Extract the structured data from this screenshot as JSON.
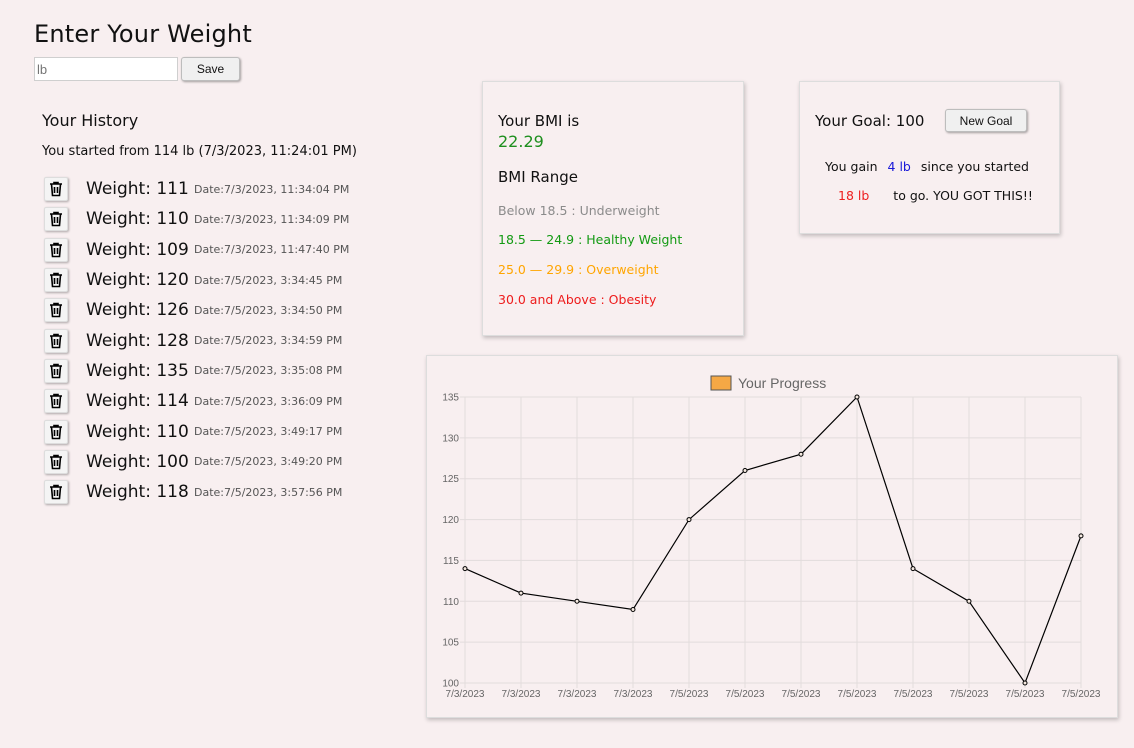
{
  "entry": {
    "title": "Enter Your Weight",
    "placeholder": "lb",
    "save_label": "Save"
  },
  "history": {
    "title": "Your History",
    "started_text": "You started from 114 lb (7/3/2023, 11:24:01 PM)",
    "items": [
      {
        "weight": "Weight: 111",
        "date": "Date:7/3/2023, 11:34:04 PM"
      },
      {
        "weight": "Weight: 110",
        "date": "Date:7/3/2023, 11:34:09 PM"
      },
      {
        "weight": "Weight: 109",
        "date": "Date:7/3/2023, 11:47:40 PM"
      },
      {
        "weight": "Weight: 120",
        "date": "Date:7/5/2023, 3:34:45 PM"
      },
      {
        "weight": "Weight: 126",
        "date": "Date:7/5/2023, 3:34:50 PM"
      },
      {
        "weight": "Weight: 128",
        "date": "Date:7/5/2023, 3:34:59 PM"
      },
      {
        "weight": "Weight: 135",
        "date": "Date:7/5/2023, 3:35:08 PM"
      },
      {
        "weight": "Weight: 114",
        "date": "Date:7/5/2023, 3:36:09 PM"
      },
      {
        "weight": "Weight: 110",
        "date": "Date:7/5/2023, 3:49:17 PM"
      },
      {
        "weight": "Weight: 100",
        "date": "Date:7/5/2023, 3:49:20 PM"
      },
      {
        "weight": "Weight: 118",
        "date": "Date:7/5/2023, 3:57:56 PM"
      }
    ],
    "delete_icon": "trash-icon"
  },
  "bmi": {
    "heading": "Your BMI is",
    "value": "22.29",
    "value_color": "#1e8f1e",
    "range_heading": "BMI Range",
    "ranges": {
      "under": "Below 18.5 : Underweight",
      "healthy": "18.5 — 24.9 : Healthy Weight",
      "over": "25.0 — 29.9 : Overweight",
      "obese": "30.0 and Above : Obesity"
    }
  },
  "goal": {
    "title": "Your Goal: 100",
    "new_goal_label": "New Goal",
    "gain_prefix": "You gain",
    "gain_amount": "4 lb",
    "gain_suffix": "since you started",
    "togo_amount": "18 lb",
    "togo_suffix": "to go. YOU GOT THIS!!"
  },
  "chart_data": {
    "type": "line",
    "legend": "Your Progress",
    "legend_color": "#f5a845",
    "line_color": "#000000",
    "x": [
      "7/3/2023",
      "7/3/2023",
      "7/3/2023",
      "7/3/2023",
      "7/5/2023",
      "7/5/2023",
      "7/5/2023",
      "7/5/2023",
      "7/5/2023",
      "7/5/2023",
      "7/5/2023",
      "7/5/2023"
    ],
    "values": [
      114,
      111,
      110,
      109,
      120,
      126,
      128,
      135,
      114,
      110,
      100,
      118
    ],
    "ylim": [
      100,
      135
    ],
    "yticks": [
      100,
      105,
      110,
      115,
      120,
      125,
      130,
      135
    ],
    "grid": true,
    "legend_position": "top"
  }
}
